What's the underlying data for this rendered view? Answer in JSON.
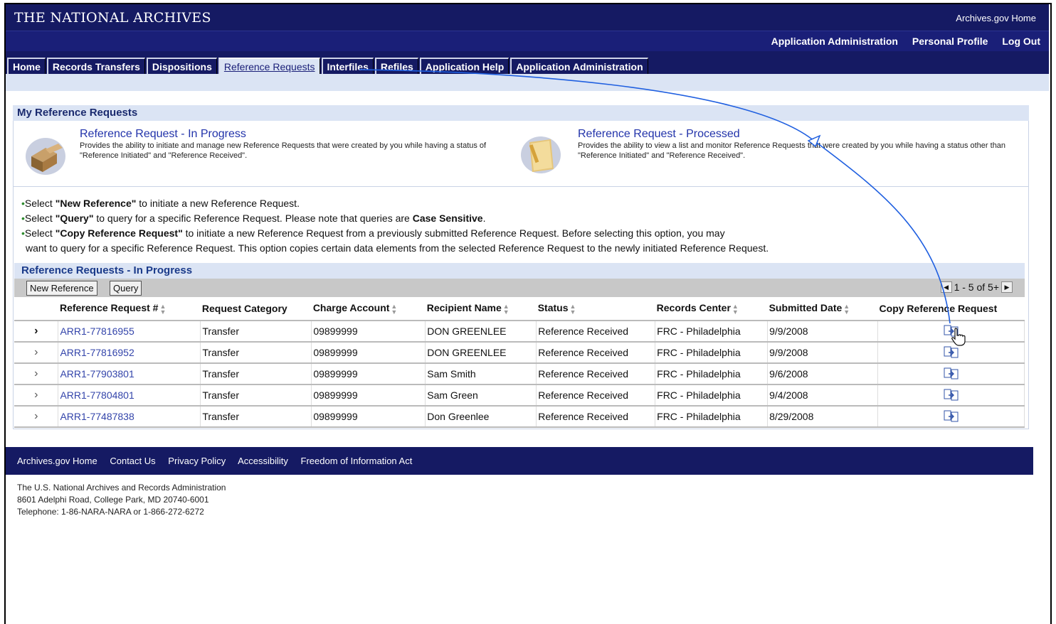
{
  "header": {
    "title": "THE NATIONAL ARCHIVES",
    "home_link": "Archives.gov Home"
  },
  "user_links": [
    "Application Administration",
    "Personal Profile",
    "Log Out"
  ],
  "tabs": [
    {
      "label": "Home"
    },
    {
      "label": "Records Transfers"
    },
    {
      "label": "Dispositions"
    },
    {
      "label": "Reference Requests",
      "active": true
    },
    {
      "label": "Interfiles"
    },
    {
      "label": "Refiles"
    },
    {
      "label": "Application Help"
    },
    {
      "label": "Application Administration"
    }
  ],
  "section": {
    "title": "My Reference Requests"
  },
  "cards": [
    {
      "title": "Reference Request - In Progress",
      "desc": "Provides the ability to initiate and manage new Reference Requests that were created by you while having a status of \"Reference Initiated\" and \"Reference Received\"."
    },
    {
      "title": "Reference Request - Processed",
      "desc": "Provides the ability to view a list and monitor Reference Requests that were created by you while having a status other than \"Reference Initiated\" and \"Reference Received\"."
    }
  ],
  "instructions": {
    "l1_pre": "Select ",
    "l1_bold": "\"New Reference\"",
    "l1_post": " to initiate a new Reference Request.",
    "l2_pre": "Select ",
    "l2_bold": "\"Query\"",
    "l2_post": " to query for a specific Reference Request. Please note that queries are ",
    "l2_bold2": "Case Sensitive",
    "l2_end": ".",
    "l3_pre": "Select ",
    "l3_bold": "\"Copy Reference Request\"",
    "l3_post": " to initiate a new Reference Request from a previously submitted Reference Request. Before selecting this option, you may",
    "l4": "want to query for a specific Reference Request. This option copies certain data elements from the selected Reference Request to the newly initiated Reference Request."
  },
  "list": {
    "title": "Reference Requests - In Progress",
    "new_btn": "New Reference",
    "query_btn": "Query",
    "pager": "1 - 5 of 5+",
    "columns": [
      "Reference Request #",
      "Request Category",
      "Charge Account",
      "Recipient Name",
      "Status",
      "Records Center",
      "Submitted Date",
      "Copy Reference Request"
    ],
    "rows": [
      {
        "id": "ARR1-77816955",
        "category": "Transfer",
        "account": "09899999",
        "recipient": "DON GREENLEE",
        "status": "Reference Received",
        "center": "FRC - Philadelphia",
        "date": "9/9/2008"
      },
      {
        "id": "ARR1-77816952",
        "category": "Transfer",
        "account": "09899999",
        "recipient": "DON GREENLEE",
        "status": "Reference Received",
        "center": "FRC - Philadelphia",
        "date": "9/9/2008"
      },
      {
        "id": "ARR1-77903801",
        "category": "Transfer",
        "account": "09899999",
        "recipient": "Sam Smith",
        "status": "Reference Received",
        "center": "FRC - Philadelphia",
        "date": "9/6/2008"
      },
      {
        "id": "ARR1-77804801",
        "category": "Transfer",
        "account": "09899999",
        "recipient": "Sam Green",
        "status": "Reference Received",
        "center": "FRC - Philadelphia",
        "date": "9/4/2008"
      },
      {
        "id": "ARR1-77487838",
        "category": "Transfer",
        "account": "09899999",
        "recipient": "Don Greenlee",
        "status": "Reference Received",
        "center": "FRC - Philadelphia",
        "date": "8/29/2008"
      }
    ]
  },
  "footer": {
    "links": [
      "Archives.gov Home",
      "Contact Us",
      "Privacy Policy",
      "Accessibility",
      "Freedom of Information Act"
    ],
    "address": [
      "The U.S. National Archives and Records Administration",
      "8601 Adelphi Road, College Park, MD 20740-6001",
      "Telephone: 1-86-NARA-NARA or 1-866-272-6272"
    ]
  },
  "colors": {
    "navy": "#151a63",
    "light": "#dbe4f4",
    "link": "#3344aa",
    "accent_curve": "#1f5fe0"
  }
}
